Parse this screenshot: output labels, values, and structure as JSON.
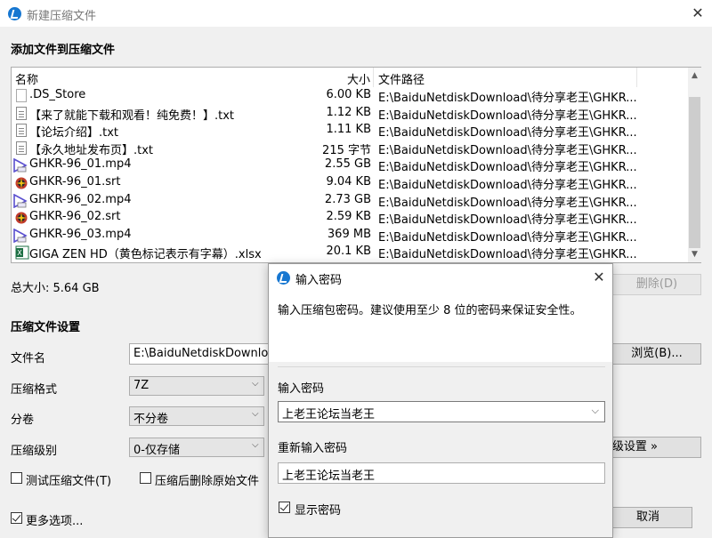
{
  "window": {
    "title": "新建压缩文件",
    "close_glyph": "✕"
  },
  "section_add_title": "添加文件到压缩文件",
  "columns": {
    "name": "名称",
    "size": "大小",
    "path": "文件路径"
  },
  "files": [
    {
      "name": ".DS_Store",
      "size": "6.00 KB",
      "path": "E:\\BaiduNetdiskDownload\\待分享老王\\GHKR...",
      "icon": "blank-file-icon"
    },
    {
      "name": "【来了就能下载和观看！纯免费！】.txt",
      "size": "1.12 KB",
      "path": "E:\\BaiduNetdiskDownload\\待分享老王\\GHKR...",
      "icon": "text-file-icon"
    },
    {
      "name": "【论坛介绍】.txt",
      "size": "1.11 KB",
      "path": "E:\\BaiduNetdiskDownload\\待分享老王\\GHKR...",
      "icon": "text-file-icon"
    },
    {
      "name": "【永久地址发布页】.txt",
      "size": "215 字节",
      "path": "E:\\BaiduNetdiskDownload\\待分享老王\\GHKR...",
      "icon": "text-file-icon"
    },
    {
      "name": "GHKR-96_01.mp4",
      "size": "2.55 GB",
      "path": "E:\\BaiduNetdiskDownload\\待分享老王\\GHKR...",
      "icon": "video-file-icon"
    },
    {
      "name": "GHKR-96_01.srt",
      "size": "9.04 KB",
      "path": "E:\\BaiduNetdiskDownload\\待分享老王\\GHKR...",
      "icon": "subtitle-file-icon"
    },
    {
      "name": "GHKR-96_02.mp4",
      "size": "2.73 GB",
      "path": "E:\\BaiduNetdiskDownload\\待分享老王\\GHKR...",
      "icon": "video-file-icon"
    },
    {
      "name": "GHKR-96_02.srt",
      "size": "2.59 KB",
      "path": "E:\\BaiduNetdiskDownload\\待分享老王\\GHKR...",
      "icon": "subtitle-file-icon"
    },
    {
      "name": "GHKR-96_03.mp4",
      "size": "369 MB",
      "path": "E:\\BaiduNetdiskDownload\\待分享老王\\GHKR...",
      "icon": "video-file-icon"
    },
    {
      "name": "GIGA ZEN HD（黄色标记表示有字幕）.xlsx",
      "size": "20.1 KB",
      "path": "E:\\BaiduNetdiskDownload\\待分享老王\\GHKR...",
      "icon": "excel-file-icon"
    }
  ],
  "total_size": "总大小: 5.64 GB",
  "delete_button": "删除(D)",
  "settings_title": "压缩文件设置",
  "filename": {
    "label": "文件名",
    "value": "E:\\BaiduNetdiskDownloa"
  },
  "browse_button": "浏览(B)...",
  "format": {
    "label": "压缩格式",
    "value": "7Z"
  },
  "volume": {
    "label": "分卷",
    "value": "不分卷"
  },
  "level": {
    "label": "压缩级别",
    "value": "0-仅存储"
  },
  "advanced_button": "级设置 »",
  "test_checkbox": "测试压缩文件(T)",
  "delete_after_checkbox": "压缩后删除原始文件",
  "more_options": "更多选项...",
  "cancel_button": "取消",
  "password_dialog": {
    "title": "输入密码",
    "close_glyph": "✕",
    "description": "输入压缩包密码。建议使用至少 8 位的密码来保证安全性。",
    "password_label": "输入密码",
    "password_value": "上老王论坛当老王",
    "confirm_label": "重新输入密码",
    "confirm_value": "上老王论坛当老王",
    "show_password_label": "显示密码"
  },
  "colors": {
    "accent": "#1777d1",
    "video_icon": "#5a4fcf",
    "srt_icon": "#c0392b",
    "excel_icon": "#1d7044"
  }
}
